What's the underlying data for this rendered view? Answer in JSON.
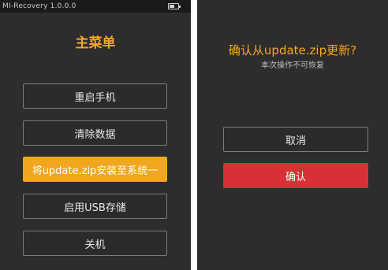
{
  "left_screen": {
    "status_bar": {
      "title": "MI-Recovery 1.0.0.0",
      "battery_icon": "battery-icon",
      "battery_level": 0.6
    },
    "menu_title": "主菜单",
    "menu_items": [
      {
        "label": "重启手机",
        "selected": false
      },
      {
        "label": "清除数据",
        "selected": false
      },
      {
        "label": "将update.zip安装至系统一",
        "selected": true
      },
      {
        "label": "启用USB存储",
        "selected": false
      },
      {
        "label": "关机",
        "selected": false
      }
    ]
  },
  "right_screen": {
    "confirm_title": "确认从update.zip更新?",
    "confirm_subtitle": "本次操作不可恢复",
    "cancel_label": "取消",
    "confirm_label": "确认"
  },
  "colors": {
    "background": "#2d2d2d",
    "status_bar": "#1a1a1a",
    "accent_orange": "#f0a61d",
    "confirm_red": "#d63235",
    "button_border": "#7c7c7c"
  }
}
